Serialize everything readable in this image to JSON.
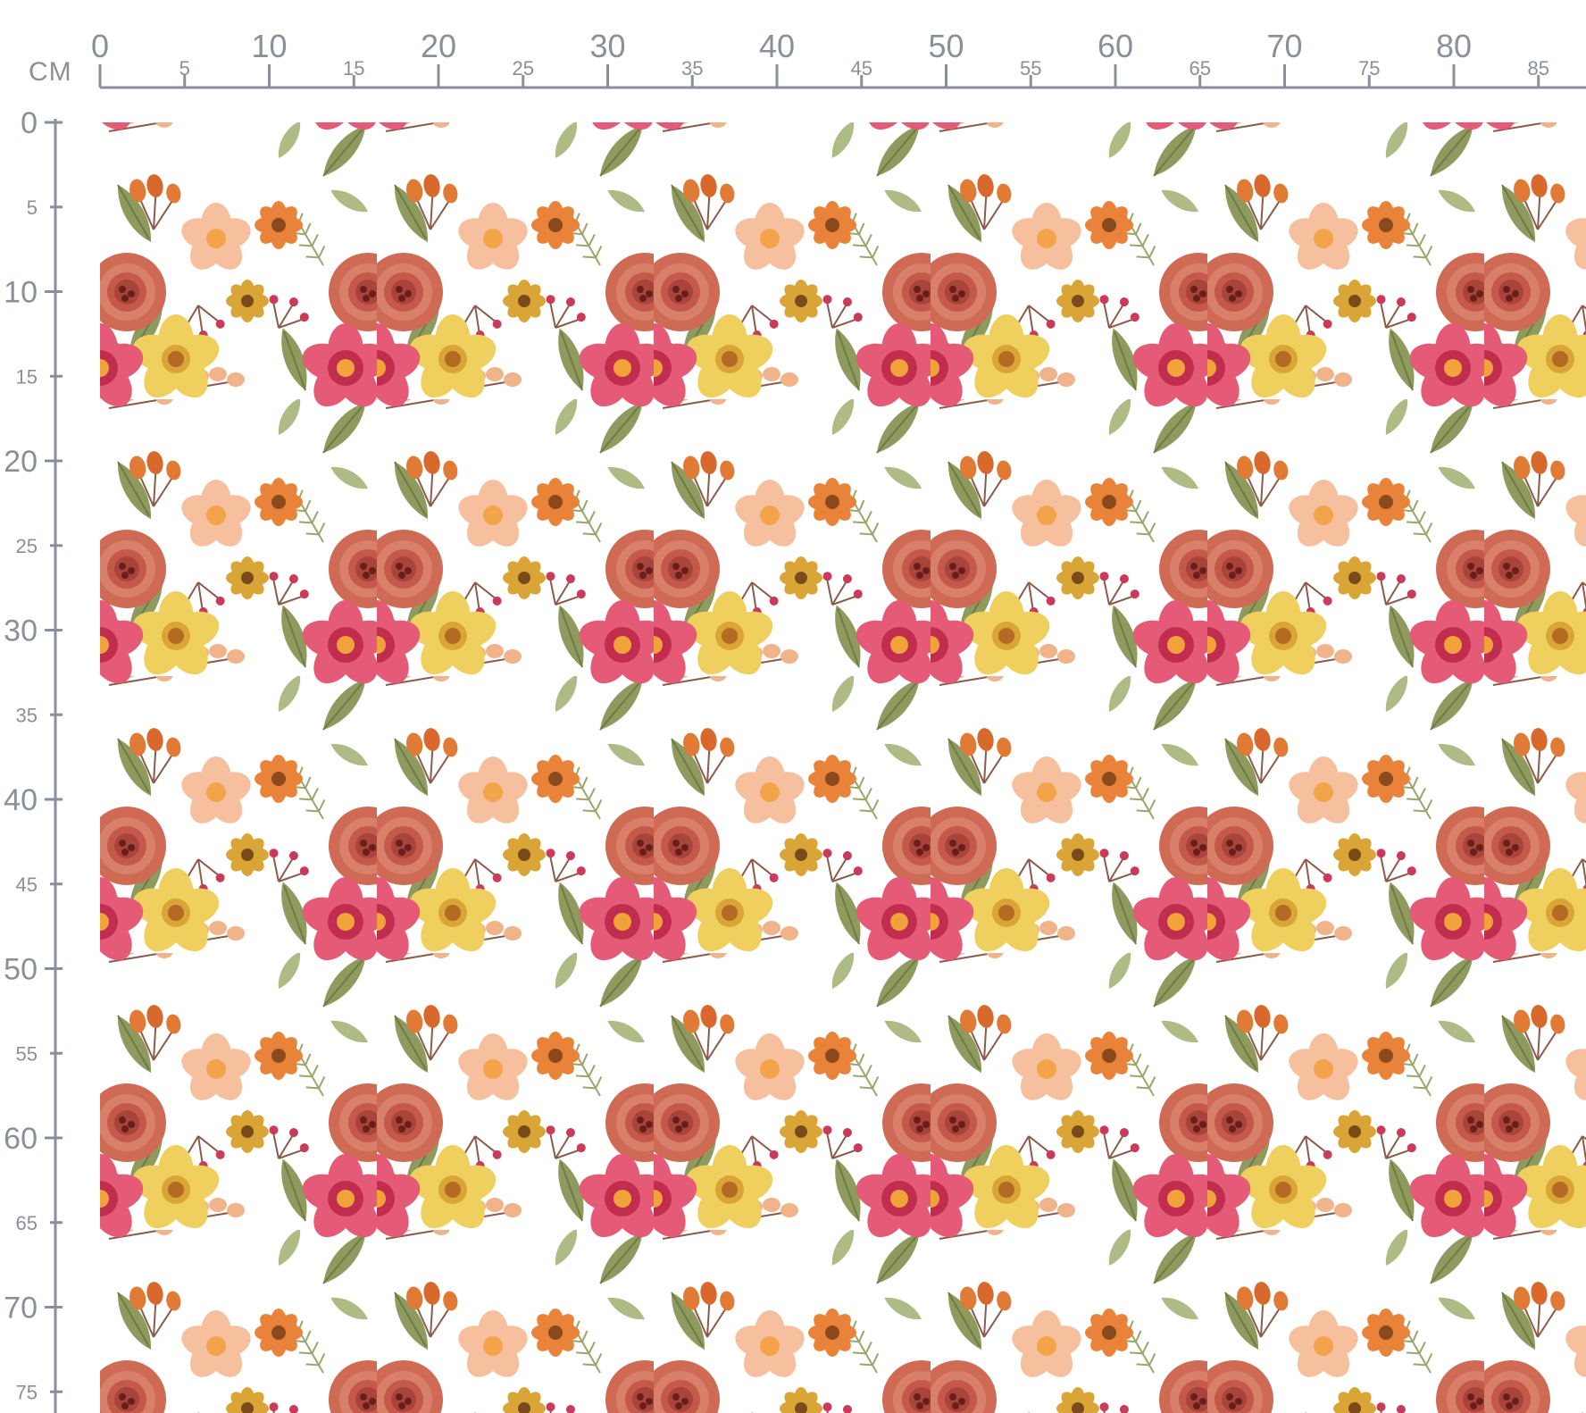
{
  "unit_label": "CM",
  "ruler": {
    "horizontal_labels": [
      "0",
      "5",
      "10",
      "15",
      "20",
      "25",
      "30",
      "35",
      "40",
      "45",
      "50",
      "55",
      "60",
      "65",
      "70",
      "75",
      "80",
      "85"
    ],
    "vertical_labels": [
      "0",
      "5",
      "10",
      "15",
      "20",
      "25",
      "30",
      "35",
      "40",
      "45",
      "50",
      "55",
      "60",
      "65",
      "70",
      "75"
    ],
    "major_every_cm": 10,
    "label_every_cm": 5
  },
  "fabric": {
    "pattern": "floral",
    "background_color": "#ffffff",
    "colors": {
      "rose": "#cf6a55",
      "rose_dark": "#a9443a",
      "magenta": "#d3405f",
      "yellow": "#efcf5d",
      "peach": "#f6c09f",
      "orange": "#e98339",
      "mustard": "#d8a536",
      "leaf": "#8f9a5f",
      "leaf_light": "#aebb84",
      "berry": "#c93b5a",
      "ruler": "#8a9099"
    },
    "icons": [
      "rose-icon",
      "pink-flower-icon",
      "yellow-flower-icon",
      "peach-flower-icon",
      "orange-flower-icon",
      "leaf-icon",
      "berry-sprig-icon"
    ]
  }
}
